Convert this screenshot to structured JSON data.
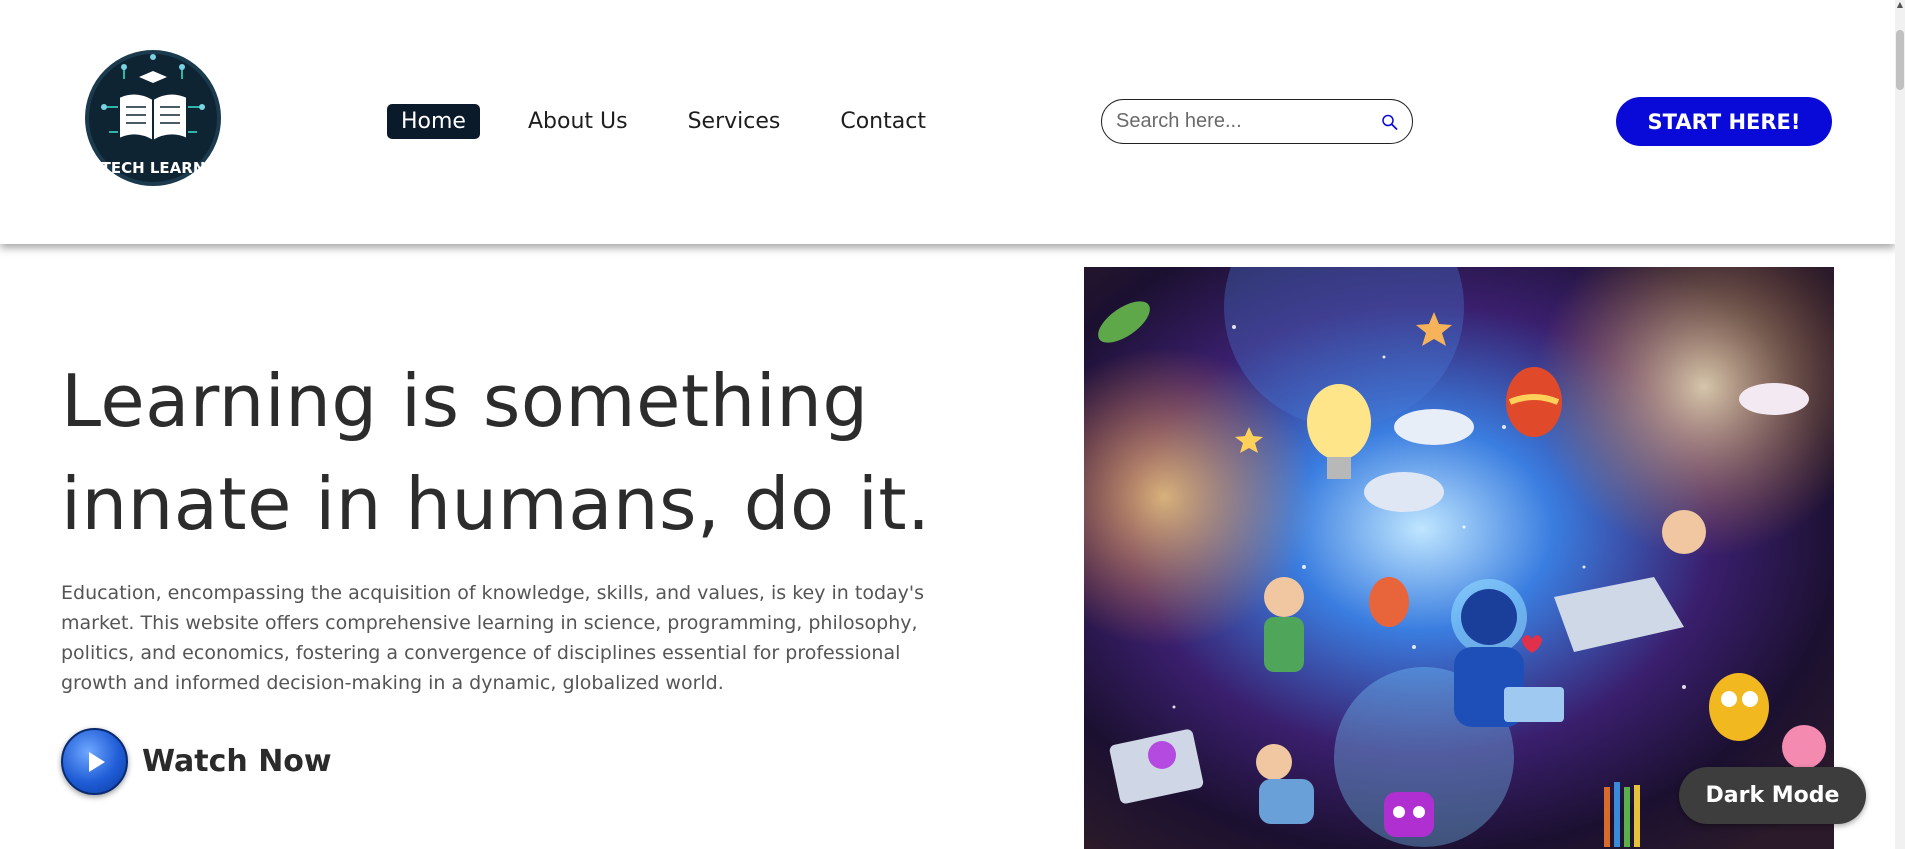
{
  "brand": {
    "logo_text": "TECH LEARN"
  },
  "nav": {
    "items": [
      {
        "label": "Home",
        "active": true
      },
      {
        "label": "About Us",
        "active": false
      },
      {
        "label": "Services",
        "active": false
      },
      {
        "label": "Contact",
        "active": false
      }
    ]
  },
  "search": {
    "placeholder": "Search here...",
    "value": "",
    "icon": "search-icon"
  },
  "cta": {
    "label": "START HERE!"
  },
  "hero": {
    "title_line1": "Learning is something",
    "title_line2": "innate in humans, do it.",
    "description": "Education, encompassing the acquisition of knowledge, skills, and values, is key in today's market. This website offers comprehensive learning in science, programming, philosophy, politics, and economics, fostering a convergence of disciplines essential for professional growth and informed decision-making in a dynamic, globalized world.",
    "watch_label": "Watch Now",
    "watch_icon": "play-icon"
  },
  "dark_mode": {
    "label": "Dark Mode"
  },
  "colors": {
    "accent": "#0a0ad8",
    "nav_active_bg": "#0b1a2a",
    "dark_button": "#3d3d3d"
  }
}
